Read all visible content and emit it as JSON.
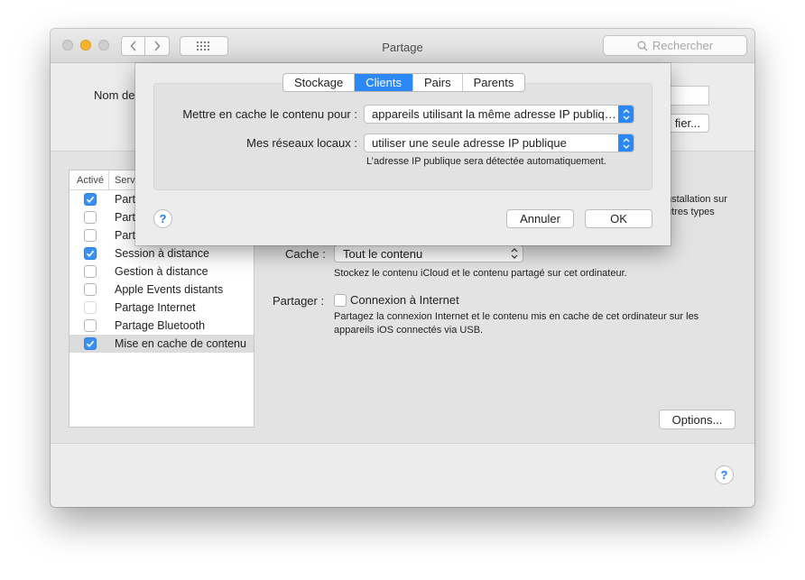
{
  "window": {
    "title": "Partage",
    "search_placeholder": "Rechercher",
    "name_label": "Nom de",
    "modify_button": "fier..."
  },
  "services": {
    "col_active": "Activé",
    "col_service": "Serv",
    "items": [
      {
        "label": "Part",
        "checked": true
      },
      {
        "label": "Part",
        "checked": false
      },
      {
        "label": "Part",
        "checked": false
      },
      {
        "label": "Session à distance",
        "checked": true
      },
      {
        "label": "Gestion à distance",
        "checked": false
      },
      {
        "label": "Apple Events distants",
        "checked": false
      },
      {
        "label": "Partage Internet",
        "checked": false,
        "disabled": true
      },
      {
        "label": "Partage Bluetooth",
        "checked": false
      },
      {
        "label": "Mise en cache de contenu",
        "checked": true,
        "selected": true
      }
    ]
  },
  "detail": {
    "right_desc_1": "nstallation sur",
    "right_desc_2": "utres types",
    "cache_label": "Cache :",
    "cache_value": "Tout le contenu",
    "cache_desc": "Stockez le contenu iCloud et le contenu partagé sur cet ordinateur.",
    "share_label": "Partager :",
    "share_option": "Connexion à Internet",
    "share_desc_1": "Partagez la connexion Internet et le contenu mis en cache de cet ordinateur sur les",
    "share_desc_2": "appareils iOS connectés via USB.",
    "options_button": "Options...",
    "help": "?"
  },
  "sheet": {
    "tabs": [
      "Stockage",
      "Clients",
      "Pairs",
      "Parents"
    ],
    "active_tab": "Clients",
    "cache_for_label": "Mettre en cache le contenu pour :",
    "cache_for_value": "appareils utilisant la même adresse IP publique",
    "networks_label": "Mes réseaux locaux :",
    "networks_value": "utiliser une seule adresse IP publique",
    "hint": "L’adresse IP publique sera détectée automatiquement.",
    "help": "?",
    "cancel_button": "Annuler",
    "ok_button": "OK"
  },
  "colors": {
    "accent": "#2b88f5",
    "checkbox_on": "#3a8ff3",
    "traffic_min": "#f6b52c"
  }
}
